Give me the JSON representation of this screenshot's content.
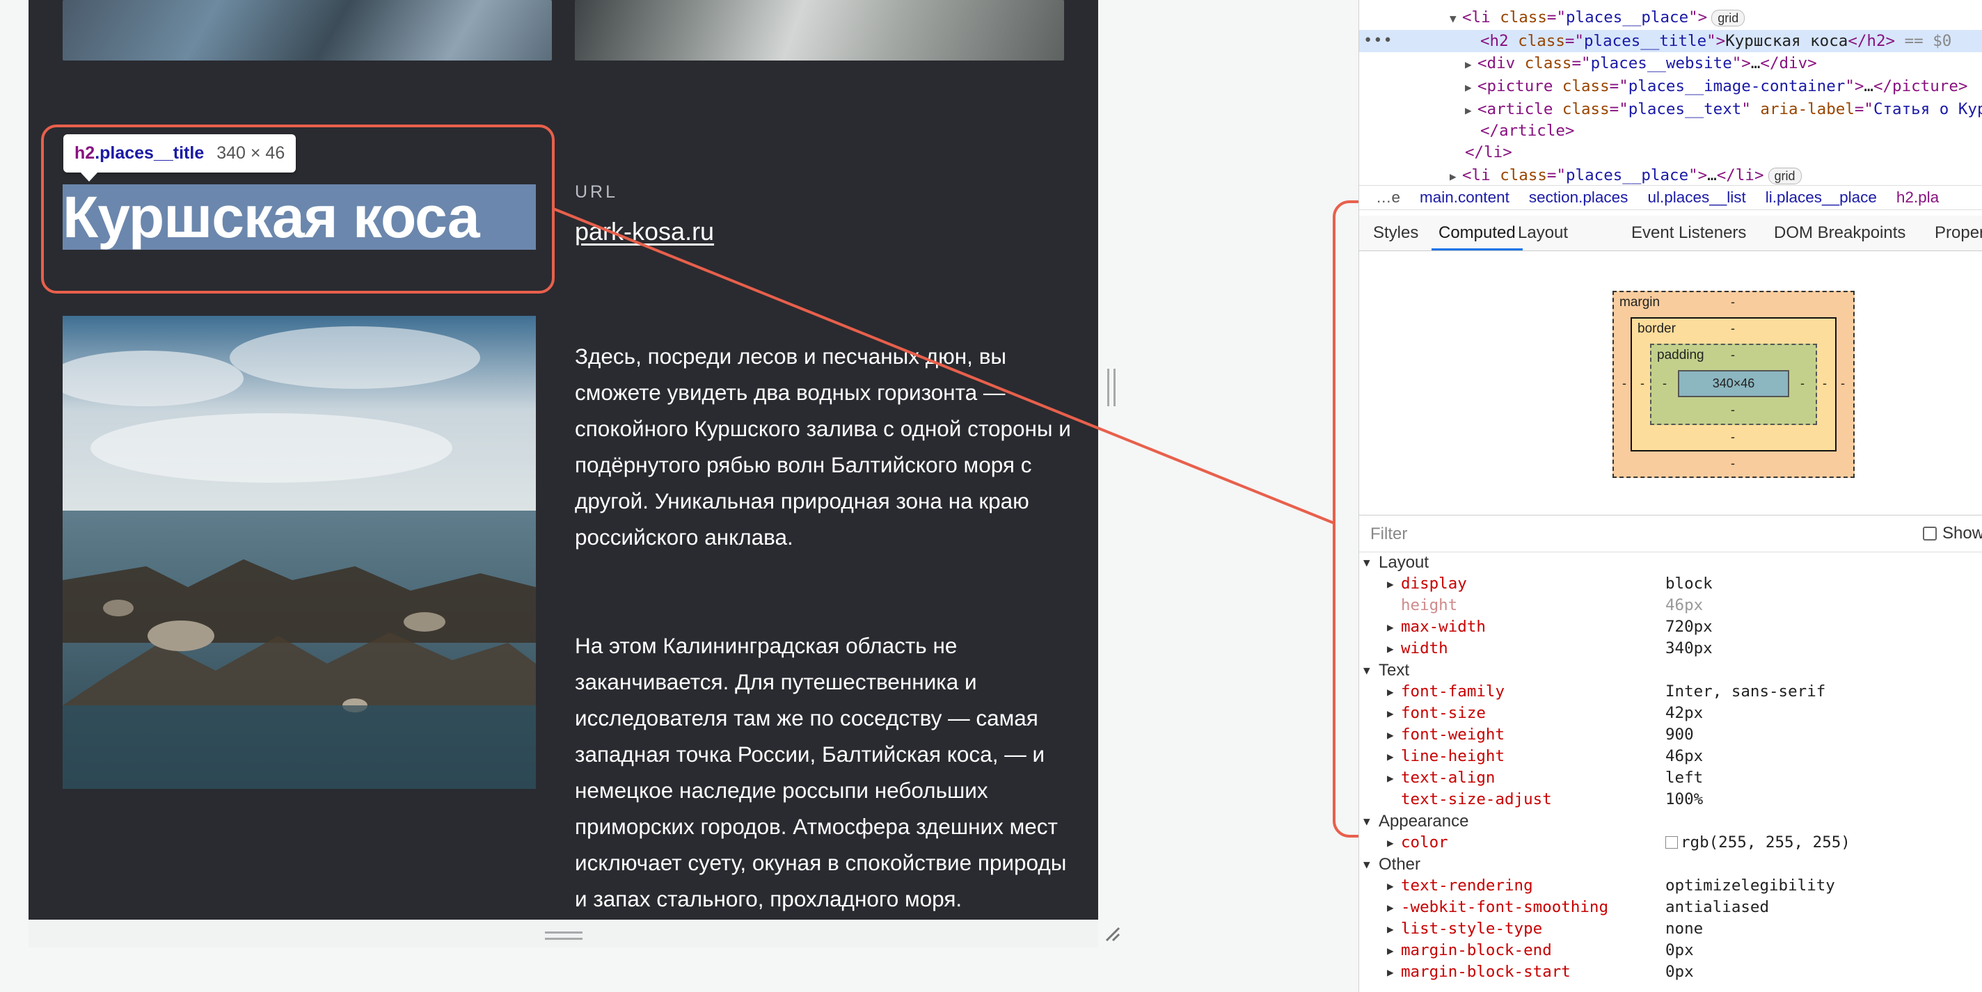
{
  "page": {
    "tooltip": {
      "tag": "h2",
      "class": ".places__title",
      "size": "340 × 46"
    },
    "title": "Куршская коса",
    "url_label": "URL",
    "url": "park-kosa.ru",
    "paragraphs": [
      "Здесь, посреди лесов и песчаных дюн, вы сможете увидеть два водных горизонта — спокойного Куршского залива с одной стороны и подёрнутого рябью волн Балтийского моря с другой. Уникальная природная зона на краю российского анклава.",
      "На этом Калининградская область не заканчивается. Для путешественника и исследователя там же по соседству — самая западная точка России, Балтийская коса, — и немецкое наследие россыпи небольших приморских городов. Атмосфера здешних мест исключает суету, окуная в спокойствие природы и запах стального, прохладного моря."
    ]
  },
  "devtools": {
    "dom": [
      {
        "open": "▼",
        "tag": "li",
        "attr": "class",
        "val": "places__place",
        "badge": "grid"
      },
      {
        "tag": "h2",
        "attr": "class",
        "val": "places__title",
        "text": "Куршская коса",
        "close": "h2",
        "eq": "== $0"
      },
      {
        "open": "▶",
        "tag": "div",
        "attr": "class",
        "val": "places__website",
        "text": "…",
        "close": "div"
      },
      {
        "open": "▶",
        "tag": "picture",
        "attr": "class",
        "val": "places__image-container",
        "text": "…",
        "close": "picture"
      },
      {
        "open": "▶",
        "tag": "article",
        "attr": "class",
        "val": "places__text",
        "attr2": "aria-label",
        "val2": "Статья о Курш"
      },
      {
        "close_only": "article"
      },
      {
        "close_only": "li"
      },
      {
        "open": "▶",
        "tag": "li",
        "attr": "class",
        "val": "places__place",
        "text": "…",
        "close": "li",
        "badge": "grid"
      }
    ],
    "breadcrumb": [
      "…e",
      "main.content",
      "section.places",
      "ul.places__list",
      "li.places__place",
      "h2.pla"
    ],
    "tabs": [
      "Styles",
      "Computed",
      "Layout",
      "Event Listeners",
      "DOM Breakpoints",
      "Proper"
    ],
    "active_tab": "Computed",
    "box_model": {
      "margin": "margin",
      "border": "border",
      "padding": "padding",
      "content": "340×46",
      "dash": "-"
    },
    "filter_placeholder": "Filter",
    "show_all": "Show",
    "sections": {
      "layout": "Layout",
      "text": "Text",
      "appearance": "Appearance",
      "other": "Other"
    },
    "props": {
      "display": {
        "name": "display",
        "value": "block"
      },
      "height": {
        "name": "height",
        "value": "46px"
      },
      "max_width": {
        "name": "max-width",
        "value": "720px"
      },
      "width": {
        "name": "width",
        "value": "340px"
      },
      "font_family": {
        "name": "font-family",
        "value": "Inter, sans-serif"
      },
      "font_size": {
        "name": "font-size",
        "value": "42px"
      },
      "font_weight": {
        "name": "font-weight",
        "value": "900"
      },
      "line_height": {
        "name": "line-height",
        "value": "46px"
      },
      "text_align": {
        "name": "text-align",
        "value": "left"
      },
      "text_size_adjust": {
        "name": "text-size-adjust",
        "value": "100%"
      },
      "color": {
        "name": "color",
        "value": "rgb(255, 255, 255)"
      },
      "text_rendering": {
        "name": "text-rendering",
        "value": "optimizelegibility"
      },
      "font_smoothing": {
        "name": "-webkit-font-smoothing",
        "value": "antialiased"
      },
      "list_style_type": {
        "name": "list-style-type",
        "value": "none"
      },
      "margin_block_end": {
        "name": "margin-block-end",
        "value": "0px"
      },
      "margin_block_start": {
        "name": "margin-block-start",
        "value": "0px"
      }
    }
  },
  "colors": {
    "accent_annotation": "#e8604c",
    "page_bg": "#2a2b30",
    "title_highlight": "#6b87ad",
    "tab_active": "#1a73e8"
  }
}
